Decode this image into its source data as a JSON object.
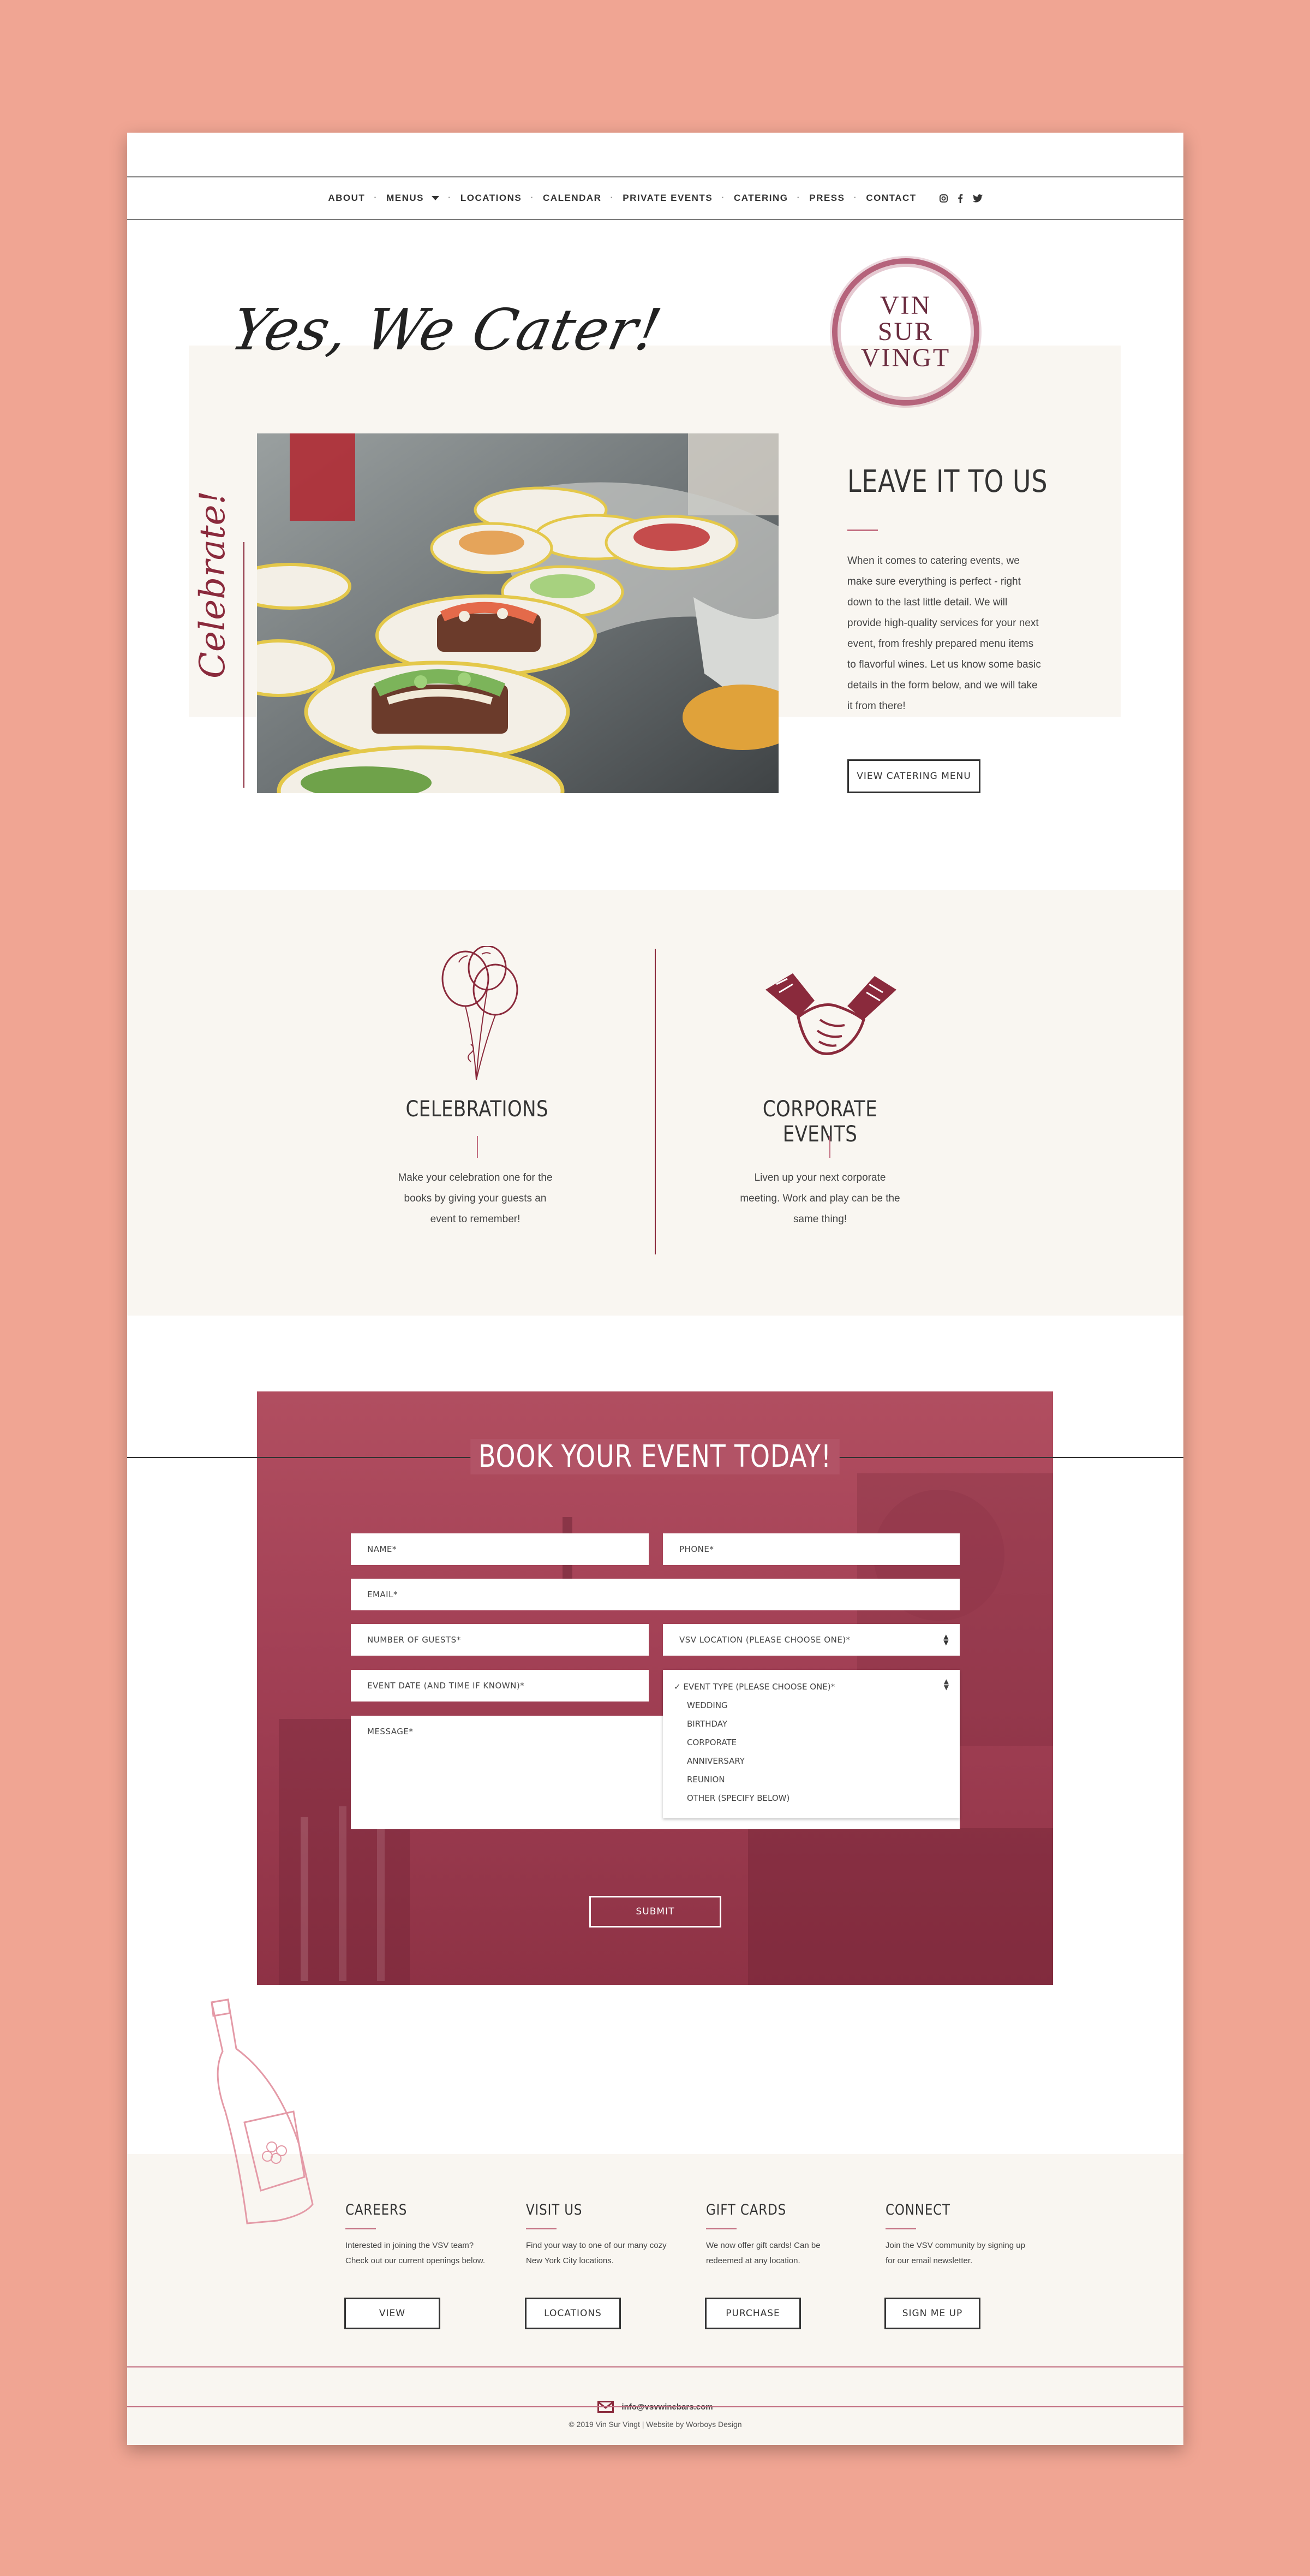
{
  "nav": {
    "items": [
      "About",
      "Menus",
      "Locations",
      "Calendar",
      "Private Events",
      "Catering",
      "Press",
      "Contact"
    ],
    "social_icons": [
      "instagram-icon",
      "facebook-icon",
      "twitter-icon"
    ]
  },
  "hero": {
    "script_title": "Yes, We Cater!",
    "logo_lines": [
      "VIN",
      "SUR",
      "VINGT"
    ],
    "side_script": "Celebrate!",
    "heading": "LEAVE IT TO US",
    "body": "When it comes to catering events, we make sure everything is perfect - right down to the last little detail. We will provide high-quality services for your next event, from freshly prepared menu items to flavorful wines. Let us know some basic details in the form below, and we will take it from there!",
    "button": "View Catering Menu"
  },
  "services": [
    {
      "icon": "balloons-icon",
      "title": "CELEBRATIONS",
      "text": "Make your celebration one for the books by giving your guests an event to remember!"
    },
    {
      "icon": "handshake-icon",
      "title": "CORPORATE EVENTS",
      "text": "Liven up your next corporate meeting. Work and play can be the same thing!"
    }
  ],
  "booking": {
    "title": "BOOK YOUR EVENT TODAY!",
    "fields": {
      "name": "Name*",
      "phone": "Phone*",
      "email": "Email*",
      "guests": "Number of Guests*",
      "location": "VSV Location (Please choose one)*",
      "event_date": "Event Date (and time if known)*",
      "event_type": "Event Type (Please choose one)*",
      "message": "Message*"
    },
    "event_type_options": [
      "Event Type (Please choose one)*",
      "Wedding",
      "Birthday",
      "Corporate",
      "Anniversary",
      "Reunion",
      "Other (specify below)"
    ],
    "submit": "Submit"
  },
  "footer": {
    "columns": [
      {
        "title": "Careers",
        "text": "Interested in joining the VSV team? Check out our current openings below.",
        "button": "View"
      },
      {
        "title": "Visit Us",
        "text": "Find your way to one of our many cozy New York City locations.",
        "button": "Locations"
      },
      {
        "title": "Gift Cards",
        "text": "We now offer gift cards! Can be redeemed at any location.",
        "button": "Purchase"
      },
      {
        "title": "Connect",
        "text": "Join the VSV community by signing up for our email newsletter.",
        "button": "Sign Me Up"
      }
    ],
    "email": "info@vsvwinebars.com",
    "copyright": "© 2019 Vin Sur Vingt | Website by Worboys Design"
  },
  "colors": {
    "background": "#f0a593",
    "accent": "#8a2a3c",
    "panel": "#b14e60",
    "cream": "#f9f6f1"
  }
}
